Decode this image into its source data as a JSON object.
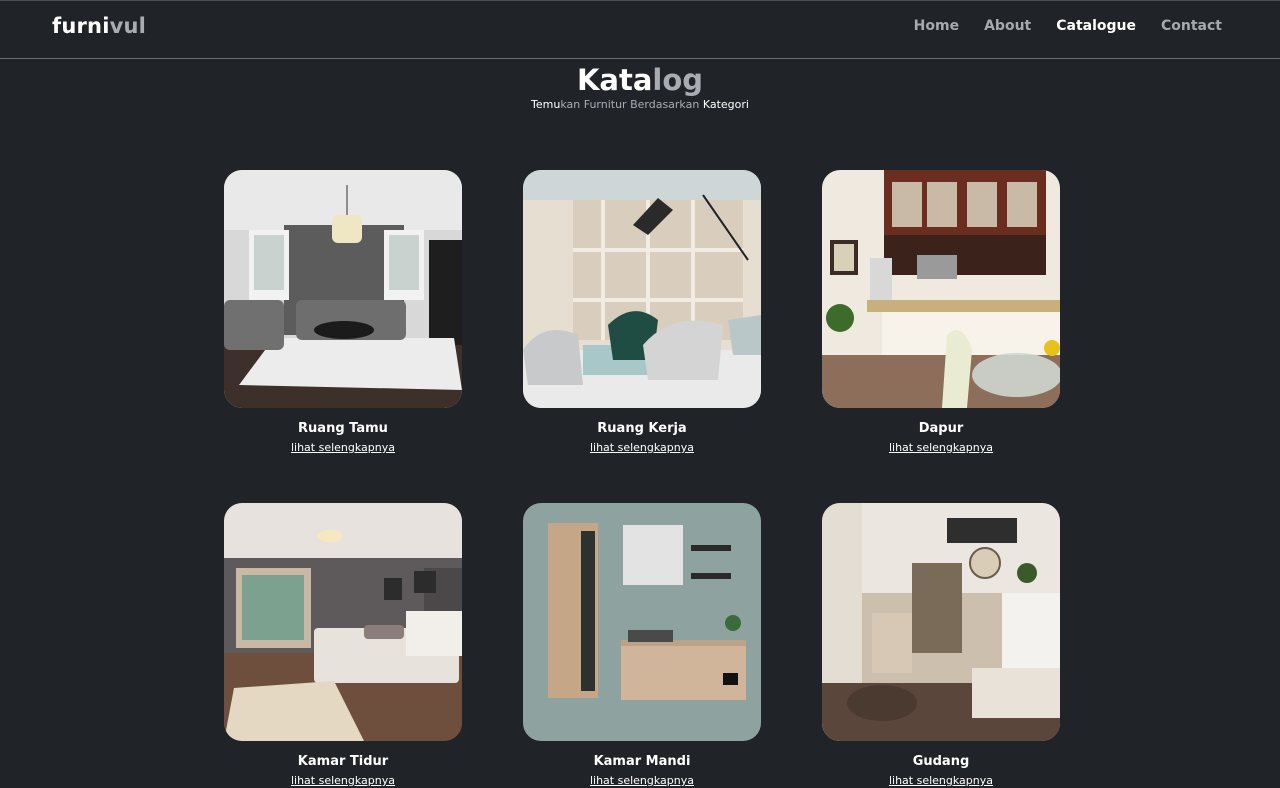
{
  "brand": {
    "part1": "furni",
    "part2": "vul"
  },
  "nav": {
    "items": [
      {
        "label": "Home",
        "active": false
      },
      {
        "label": "About",
        "active": false
      },
      {
        "label": "Catalogue",
        "active": true
      },
      {
        "label": "Contact",
        "active": false
      }
    ]
  },
  "hero": {
    "title_part1": "Kata",
    "title_part2": "log",
    "subtitle_part1": "Temu",
    "subtitle_part2": "kan Furnitur Berdasarkan ",
    "subtitle_part3": "Kategori"
  },
  "catalog": {
    "link_label": "lihat selengkapnya",
    "items": [
      {
        "title": "Ruang Tamu"
      },
      {
        "title": "Ruang Kerja"
      },
      {
        "title": "Dapur"
      },
      {
        "title": "Kamar Tidur"
      },
      {
        "title": "Kamar Mandi"
      },
      {
        "title": "Gudang"
      }
    ]
  }
}
